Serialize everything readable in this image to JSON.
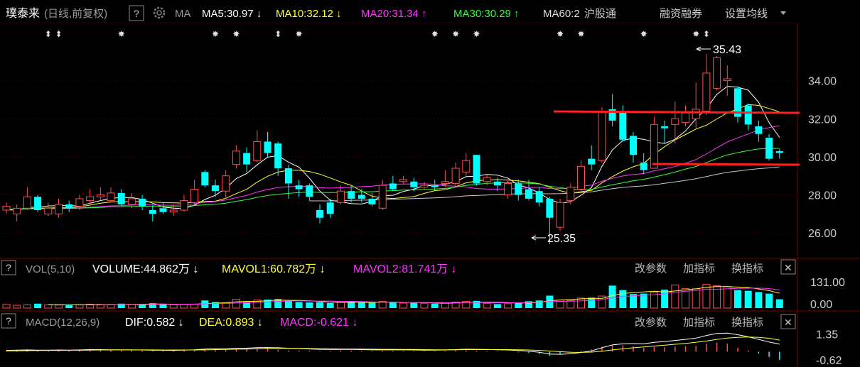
{
  "header": {
    "stock_name": "璞泰来",
    "period_label": "(日线,前复权)",
    "help": "?",
    "ma_label": "MA",
    "ma_items": [
      {
        "text": "MA5:30.97",
        "arrow": "↓",
        "color": "#ffffff"
      },
      {
        "text": "MA10:32.12",
        "arrow": "↓",
        "color": "#ffff33"
      },
      {
        "text": "MA20:31.34",
        "arrow": "↑",
        "color": "#ff33ff"
      },
      {
        "text": "MA30:30.29",
        "arrow": "↑",
        "color": "#33ff33"
      },
      {
        "text": "MA60:2",
        "arrow": "",
        "color": "#dddddd"
      }
    ],
    "links": [
      "沪股通",
      "融资融券",
      "设置均线"
    ]
  },
  "price_panel": {
    "high_label": "35.43",
    "low_label": "25.35",
    "y_ticks": [
      "34.00",
      "32.00",
      "30.00",
      "28.00",
      "26.00"
    ]
  },
  "vol_panel": {
    "help": "?",
    "title": "VOL(5,10)",
    "items": [
      {
        "text": "VOLUME:44.862万",
        "arrow": "↓",
        "color": "#ffffff"
      },
      {
        "text": "MAVOL1:60.782万",
        "arrow": "↓",
        "color": "#ffff33"
      },
      {
        "text": "MAVOL2:81.741万",
        "arrow": "↓",
        "color": "#ff33ff"
      }
    ],
    "buttons": [
      "改参数",
      "加指标",
      "换指标"
    ],
    "close": "✕",
    "y_ticks": [
      "131.00",
      "0.00"
    ]
  },
  "macd_panel": {
    "help": "?",
    "title": "MACD(12,26,9)",
    "items": [
      {
        "text": "DIF:0.582",
        "arrow": "↓",
        "color": "#ffffff"
      },
      {
        "text": "DEA:0.893",
        "arrow": "↓",
        "color": "#ffff33"
      },
      {
        "text": "MACD:-0.621",
        "arrow": "↓",
        "color": "#ff33ff"
      }
    ],
    "buttons": [
      "改参数",
      "加指标",
      "换指标"
    ],
    "close": "✕",
    "y_ticks": [
      "1.35",
      "-0.62"
    ]
  },
  "colors": {
    "up": "#ff4d4d",
    "down": "#00ffff",
    "accent_line": "#ff2020"
  },
  "chart_data": {
    "type": "candlestick",
    "price_ylim": [
      25.0,
      36.0
    ],
    "candles": [
      {
        "o": 27.2,
        "c": 27.4,
        "h": 27.6,
        "l": 27.0
      },
      {
        "o": 27.0,
        "c": 27.3,
        "h": 27.5,
        "l": 26.6
      },
      {
        "o": 27.3,
        "c": 27.9,
        "h": 28.4,
        "l": 27.2
      },
      {
        "o": 27.9,
        "c": 27.2,
        "h": 28.0,
        "l": 27.1
      },
      {
        "o": 27.0,
        "c": 27.3,
        "h": 27.6,
        "l": 26.9
      },
      {
        "o": 27.0,
        "c": 27.5,
        "h": 27.8,
        "l": 26.8
      },
      {
        "o": 27.5,
        "c": 27.3,
        "h": 27.7,
        "l": 27.1
      },
      {
        "o": 27.4,
        "c": 27.8,
        "h": 28.0,
        "l": 27.2
      },
      {
        "o": 27.7,
        "c": 27.9,
        "h": 28.3,
        "l": 27.5
      },
      {
        "o": 27.9,
        "c": 28.0,
        "h": 28.4,
        "l": 27.7
      },
      {
        "o": 27.7,
        "c": 28.1,
        "h": 28.4,
        "l": 27.6
      },
      {
        "o": 28.1,
        "c": 27.5,
        "h": 28.3,
        "l": 27.4
      },
      {
        "o": 27.5,
        "c": 27.8,
        "h": 28.1,
        "l": 27.3
      },
      {
        "o": 27.8,
        "c": 27.4,
        "h": 28.0,
        "l": 27.2
      },
      {
        "o": 27.2,
        "c": 27.0,
        "h": 27.5,
        "l": 26.6
      },
      {
        "o": 27.3,
        "c": 27.1,
        "h": 27.6,
        "l": 27.0
      },
      {
        "o": 27.1,
        "c": 27.2,
        "h": 27.5,
        "l": 26.9
      },
      {
        "o": 27.2,
        "c": 27.7,
        "h": 28.0,
        "l": 27.1
      },
      {
        "o": 27.6,
        "c": 28.3,
        "h": 28.8,
        "l": 27.5
      },
      {
        "o": 29.2,
        "c": 28.5,
        "h": 29.3,
        "l": 28.4
      },
      {
        "o": 28.5,
        "c": 28.2,
        "h": 28.8,
        "l": 27.9
      },
      {
        "o": 28.2,
        "c": 29.0,
        "h": 29.3,
        "l": 27.8
      },
      {
        "o": 29.6,
        "c": 30.3,
        "h": 30.6,
        "l": 29.4
      },
      {
        "o": 30.2,
        "c": 29.6,
        "h": 30.5,
        "l": 29.2
      },
      {
        "o": 29.8,
        "c": 30.8,
        "h": 31.4,
        "l": 29.7
      },
      {
        "o": 30.8,
        "c": 30.2,
        "h": 31.3,
        "l": 30.0
      },
      {
        "o": 30.7,
        "c": 29.4,
        "h": 30.8,
        "l": 29.0
      },
      {
        "o": 29.4,
        "c": 28.6,
        "h": 29.6,
        "l": 27.8
      },
      {
        "o": 28.5,
        "c": 28.3,
        "h": 28.8,
        "l": 27.9
      },
      {
        "o": 28.5,
        "c": 27.9,
        "h": 28.6,
        "l": 27.7
      },
      {
        "o": 27.2,
        "c": 26.8,
        "h": 27.5,
        "l": 26.5
      },
      {
        "o": 27.6,
        "c": 27.0,
        "h": 27.8,
        "l": 26.8
      },
      {
        "o": 27.6,
        "c": 28.2,
        "h": 28.5,
        "l": 27.5
      },
      {
        "o": 28.2,
        "c": 27.8,
        "h": 28.5,
        "l": 27.6
      },
      {
        "o": 28.0,
        "c": 27.8,
        "h": 28.3,
        "l": 27.6
      },
      {
        "o": 27.8,
        "c": 27.5,
        "h": 28.1,
        "l": 27.4
      },
      {
        "o": 27.3,
        "c": 28.5,
        "h": 28.8,
        "l": 27.2
      },
      {
        "o": 28.6,
        "c": 28.3,
        "h": 29.0,
        "l": 28.2
      },
      {
        "o": 28.7,
        "c": 28.8,
        "h": 29.0,
        "l": 28.6
      },
      {
        "o": 28.7,
        "c": 28.4,
        "h": 28.9,
        "l": 28.2
      },
      {
        "o": 28.4,
        "c": 28.5,
        "h": 28.7,
        "l": 28.3
      },
      {
        "o": 28.5,
        "c": 28.4,
        "h": 28.8,
        "l": 28.2
      },
      {
        "o": 28.6,
        "c": 28.7,
        "h": 29.3,
        "l": 28.4
      },
      {
        "o": 28.6,
        "c": 29.4,
        "h": 29.7,
        "l": 28.5
      },
      {
        "o": 29.2,
        "c": 29.8,
        "h": 30.2,
        "l": 29.0
      },
      {
        "o": 30.1,
        "c": 28.6,
        "h": 30.1,
        "l": 28.5
      },
      {
        "o": 28.7,
        "c": 28.9,
        "h": 29.1,
        "l": 28.5
      },
      {
        "o": 28.7,
        "c": 28.5,
        "h": 28.9,
        "l": 28.2
      },
      {
        "o": 28.0,
        "c": 28.6,
        "h": 28.8,
        "l": 27.8
      },
      {
        "o": 28.6,
        "c": 28.0,
        "h": 28.8,
        "l": 27.7
      },
      {
        "o": 28.3,
        "c": 27.8,
        "h": 28.8,
        "l": 27.7
      },
      {
        "o": 28.2,
        "c": 27.6,
        "h": 28.4,
        "l": 27.4
      },
      {
        "o": 27.8,
        "c": 26.8,
        "h": 27.9,
        "l": 25.4
      },
      {
        "o": 26.3,
        "c": 27.6,
        "h": 27.8,
        "l": 26.1
      },
      {
        "o": 27.7,
        "c": 28.4,
        "h": 28.6,
        "l": 27.5
      },
      {
        "o": 28.3,
        "c": 29.5,
        "h": 29.8,
        "l": 28.2
      },
      {
        "o": 29.9,
        "c": 29.6,
        "h": 30.6,
        "l": 29.3
      },
      {
        "o": 29.8,
        "c": 32.4,
        "h": 32.6,
        "l": 29.7
      },
      {
        "o": 32.5,
        "c": 31.9,
        "h": 33.3,
        "l": 31.6
      },
      {
        "o": 32.4,
        "c": 30.9,
        "h": 32.7,
        "l": 30.8
      },
      {
        "o": 31.1,
        "c": 30.1,
        "h": 31.3,
        "l": 29.7
      },
      {
        "o": 29.7,
        "c": 29.3,
        "h": 30.2,
        "l": 29.1
      },
      {
        "o": 29.4,
        "c": 31.7,
        "h": 32.1,
        "l": 29.4
      },
      {
        "o": 31.6,
        "c": 31.5,
        "h": 31.9,
        "l": 30.7
      },
      {
        "o": 31.7,
        "c": 32.0,
        "h": 32.9,
        "l": 30.7
      },
      {
        "o": 31.8,
        "c": 32.3,
        "h": 32.7,
        "l": 31.6
      },
      {
        "o": 32.0,
        "c": 32.5,
        "h": 33.9,
        "l": 31.5
      },
      {
        "o": 32.4,
        "c": 34.4,
        "h": 35.4,
        "l": 32.2
      },
      {
        "o": 33.6,
        "c": 35.2,
        "h": 35.3,
        "l": 33.5
      },
      {
        "o": 34.0,
        "c": 34.1,
        "h": 34.8,
        "l": 33.2
      },
      {
        "o": 33.6,
        "c": 32.1,
        "h": 33.7,
        "l": 31.8
      },
      {
        "o": 32.7,
        "c": 31.7,
        "h": 32.8,
        "l": 31.4
      },
      {
        "o": 31.6,
        "c": 31.2,
        "h": 31.9,
        "l": 30.8
      },
      {
        "o": 31.0,
        "c": 29.9,
        "h": 31.2,
        "l": 29.8
      },
      {
        "o": 30.3,
        "c": 30.2,
        "h": 30.4,
        "l": 29.9
      }
    ],
    "volume_ylim": [
      0,
      131
    ],
    "volumes": [
      18,
      14,
      16,
      22,
      16,
      15,
      14,
      16,
      19,
      18,
      18,
      22,
      17,
      20,
      24,
      18,
      17,
      18,
      20,
      38,
      30,
      26,
      44,
      30,
      40,
      42,
      45,
      36,
      30,
      28,
      30,
      25,
      28,
      32,
      28,
      26,
      34,
      28,
      25,
      26,
      24,
      22,
      25,
      30,
      34,
      36,
      24,
      20,
      22,
      28,
      34,
      38,
      62,
      40,
      38,
      50,
      52,
      60,
      112,
      90,
      70,
      72,
      78,
      92,
      115,
      98,
      96,
      118,
      112,
      108,
      90,
      86,
      80,
      72,
      44
    ],
    "mavol1": [],
    "mavol2": [],
    "macd_ylim": [
      -0.9,
      1.6
    ],
    "macd_hist": [
      0.1,
      0.15,
      0.12,
      0.08,
      0.12,
      0.14,
      0.1,
      0.15,
      0.18,
      0.14,
      0.12,
      0.1,
      0.14,
      0.1,
      0.06,
      0.1,
      0.08,
      0.12,
      0.16,
      0.2,
      0.18,
      0.14,
      0.22,
      0.18,
      0.26,
      0.22,
      0.16,
      0.1,
      0.08,
      0.06,
      0.04,
      0.06,
      0.1,
      0.08,
      0.06,
      0.04,
      0.08,
      0.06,
      0.05,
      0.04,
      0.03,
      0.04,
      0.06,
      0.1,
      0.12,
      0.08,
      0.06,
      0.04,
      0.02,
      -0.05,
      -0.1,
      -0.18,
      -0.32,
      -0.16,
      -0.06,
      0.08,
      0.16,
      0.38,
      0.55,
      0.48,
      0.4,
      0.3,
      0.36,
      0.34,
      0.4,
      0.42,
      0.45,
      0.6,
      0.7,
      0.62,
      0.3,
      0.1,
      -0.15,
      -0.4,
      -0.62
    ],
    "dif": [
      0.1,
      0.12,
      0.14,
      0.12,
      0.12,
      0.13,
      0.12,
      0.14,
      0.16,
      0.16,
      0.15,
      0.14,
      0.14,
      0.13,
      0.11,
      0.11,
      0.1,
      0.12,
      0.15,
      0.2,
      0.22,
      0.22,
      0.26,
      0.27,
      0.31,
      0.32,
      0.3,
      0.27,
      0.24,
      0.21,
      0.18,
      0.17,
      0.18,
      0.17,
      0.16,
      0.14,
      0.15,
      0.14,
      0.14,
      0.13,
      0.12,
      0.12,
      0.13,
      0.16,
      0.19,
      0.18,
      0.17,
      0.15,
      0.13,
      0.09,
      0.04,
      -0.04,
      -0.18,
      -0.2,
      -0.16,
      -0.06,
      0.06,
      0.3,
      0.52,
      0.6,
      0.62,
      0.6,
      0.72,
      0.78,
      0.86,
      0.94,
      1.04,
      1.24,
      1.4,
      1.42,
      1.3,
      1.14,
      0.94,
      0.74,
      0.58
    ],
    "dea": [
      0.06,
      0.07,
      0.08,
      0.09,
      0.1,
      0.1,
      0.11,
      0.11,
      0.12,
      0.13,
      0.13,
      0.14,
      0.14,
      0.14,
      0.14,
      0.13,
      0.13,
      0.13,
      0.13,
      0.14,
      0.16,
      0.17,
      0.19,
      0.2,
      0.22,
      0.24,
      0.25,
      0.25,
      0.25,
      0.24,
      0.23,
      0.22,
      0.21,
      0.21,
      0.2,
      0.19,
      0.18,
      0.18,
      0.17,
      0.17,
      0.16,
      0.15,
      0.15,
      0.15,
      0.16,
      0.16,
      0.16,
      0.16,
      0.16,
      0.15,
      0.13,
      0.1,
      0.05,
      0.0,
      -0.04,
      -0.05,
      -0.03,
      0.04,
      0.13,
      0.22,
      0.3,
      0.36,
      0.43,
      0.5,
      0.57,
      0.64,
      0.72,
      0.82,
      0.94,
      1.04,
      1.1,
      1.12,
      1.1,
      1.03,
      0.89
    ]
  }
}
